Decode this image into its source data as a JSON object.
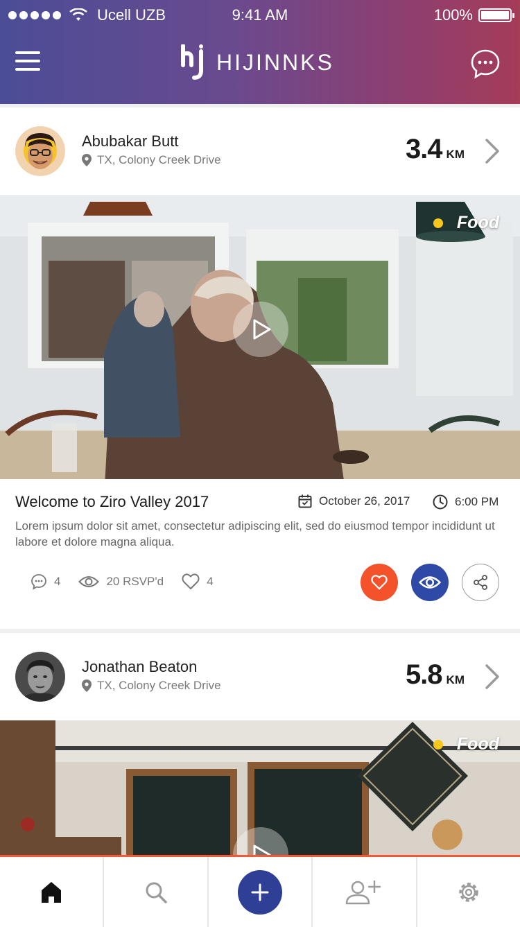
{
  "status_bar": {
    "carrier": "Ucell UZB",
    "time": "9:41 AM",
    "battery": "100%"
  },
  "header": {
    "brand": "HIJINNKS",
    "menu_icon": "hamburger-menu-icon",
    "chat_icon": "chat-bubble-icon"
  },
  "posts": [
    {
      "user_name": "Abubakar Butt",
      "location": "TX, Colony Creek Drive",
      "distance_value": "3.4",
      "distance_unit": "KM",
      "category": "Food",
      "event_title": "Welcome to Ziro Valley 2017",
      "event_date": "October 26, 2017",
      "event_time": "6:00 PM",
      "event_description": "Lorem ipsum dolor sit amet, consectetur adipiscing elit, sed do eiusmod tempor incididunt ut labore et dolore magna aliqua.",
      "comments": "4",
      "rsvp": "20 RSVP'd",
      "likes": "4"
    },
    {
      "user_name": "Jonathan Beaton",
      "location": "TX, Colony Creek Drive",
      "distance_value": "5.8",
      "distance_unit": "KM",
      "category": "Food"
    }
  ],
  "colors": {
    "header_start": "#4b4d96",
    "header_end": "#a53c58",
    "like": "#f4522a",
    "watch": "#2e4aa6",
    "add": "#2e3f95",
    "category_dot": "#f6c81e"
  },
  "tabbar": {
    "items": [
      "home-icon",
      "search-icon",
      "add-icon",
      "add-user-icon",
      "settings-icon"
    ]
  }
}
